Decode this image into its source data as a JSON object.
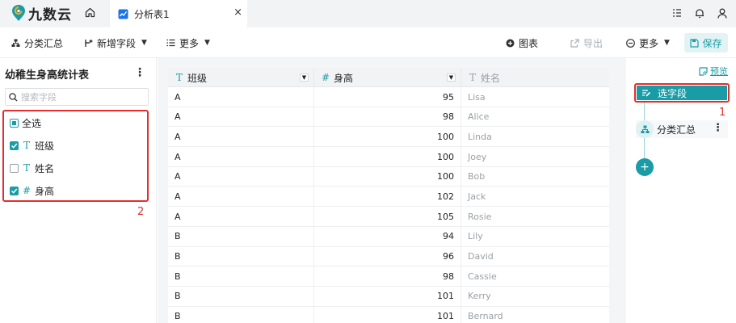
{
  "app": {
    "brand": "九数云"
  },
  "tabs": {
    "active_label": "分析表1",
    "close_glyph": "×"
  },
  "toolbar": {
    "group_summary": "分类汇总",
    "add_field": "新增字段",
    "more_left": "更多",
    "chart": "图表",
    "export": "导出",
    "more_right": "更多",
    "save": "保存"
  },
  "left_panel": {
    "title": "幼稚生身高统计表",
    "more_glyph": "⋮",
    "search_placeholder": "搜索字段",
    "select_all": "全选",
    "fields": [
      {
        "label": "班级",
        "type": "text",
        "checked": true
      },
      {
        "label": "姓名",
        "type": "text",
        "checked": false
      },
      {
        "label": "身高",
        "type": "number",
        "checked": true
      }
    ],
    "annotation": "2"
  },
  "grid": {
    "columns": [
      {
        "label": "班级",
        "type_glyph": "T"
      },
      {
        "label": "身高",
        "type_glyph": "#"
      },
      {
        "label": "姓名",
        "type_glyph": "T"
      }
    ],
    "dropdown_glyph": "▼",
    "rows": [
      [
        "A",
        "95",
        "Lisa"
      ],
      [
        "A",
        "98",
        "Alice"
      ],
      [
        "A",
        "100",
        "Linda"
      ],
      [
        "A",
        "100",
        "Joey"
      ],
      [
        "A",
        "100",
        "Bob"
      ],
      [
        "A",
        "102",
        "Jack"
      ],
      [
        "A",
        "105",
        "Rosie"
      ],
      [
        "B",
        "94",
        "Lily"
      ],
      [
        "B",
        "96",
        "David"
      ],
      [
        "B",
        "98",
        "Cassie"
      ],
      [
        "B",
        "101",
        "Kerry"
      ],
      [
        "B",
        "101",
        "Bernard"
      ]
    ]
  },
  "flow": {
    "preview": "预览",
    "step_select": "选字段",
    "step_group": "分类汇总",
    "step_more_glyph": "⋮",
    "add_glyph": "+",
    "annotation": "1"
  },
  "colors": {
    "accent": "#1a9ca6",
    "annotation": "#e0302f",
    "topbar": "#f2f3f5"
  }
}
